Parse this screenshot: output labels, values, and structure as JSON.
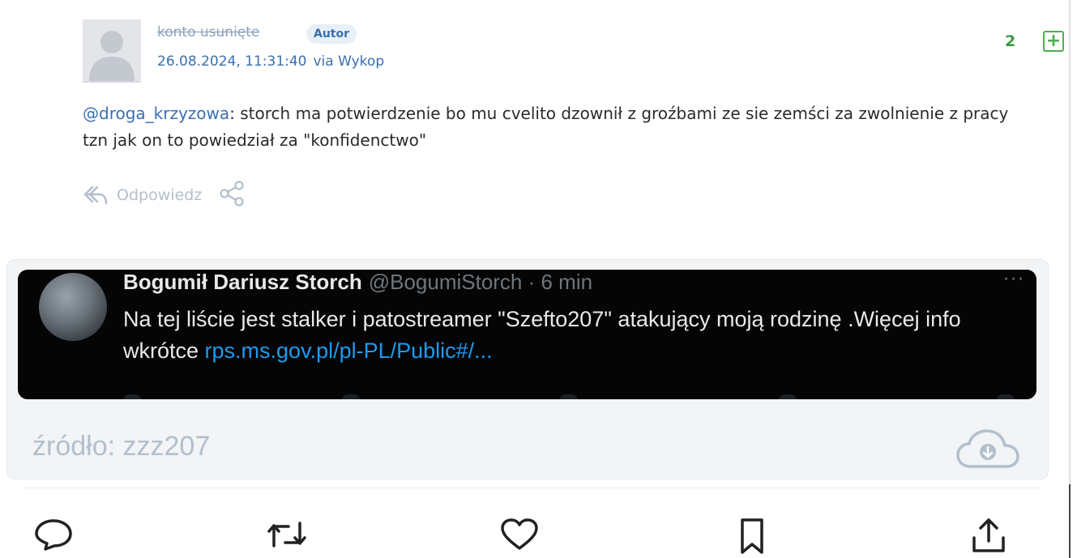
{
  "post": {
    "author": "konto usunięte",
    "badge": "Autor",
    "date": "26.08.2024, 11:31:40",
    "via": "via Wykop",
    "votes": "2",
    "plus_label": "+",
    "mention": "@droga_krzyzowa",
    "text": ": storch ma potwierdzenie bo mu cvelito dzownił z groźbami ze sie zemści za zwolnienie z pracy tzn jak on to powiedział za \"konfidenctwo\"",
    "reply_label": "Odpowiedz"
  },
  "embed": {
    "tweet": {
      "name": "Bogumił Dariusz Storch",
      "handle": "@BogumiStorch · 6 min",
      "more": "···",
      "text": "Na tej liście jest stalker i patostreamer \"Szefto207\" atakujący moją rodzinę .Więcej info wkrótce ",
      "link": "rps.ms.gov.pl/pl-PL/Public#/..."
    },
    "source": "źródło: zzz207"
  },
  "icons": {
    "avatar": "user-placeholder-icon",
    "reply": "reply-icon",
    "share": "share-icon",
    "download": "cloud-download-icon",
    "bottom": [
      "comment-icon",
      "retweet-icon",
      "like-icon",
      "bookmark-icon",
      "share-upload-icon"
    ]
  },
  "colors": {
    "link": "#3b6fb0",
    "vote_positive": "#3d9a42",
    "tweet_link": "#1d9bf0",
    "muted": "#b3bfcc"
  }
}
